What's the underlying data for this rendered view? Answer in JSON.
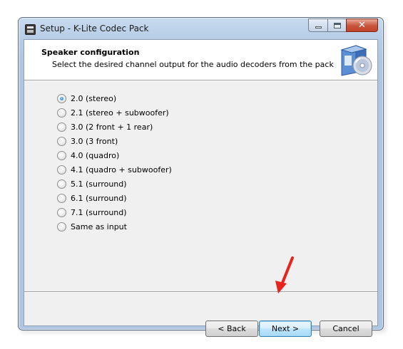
{
  "window": {
    "title": "Setup - K-Lite Codec Pack"
  },
  "header": {
    "title": "Speaker configuration",
    "subtitle": "Select the desired channel output for the audio decoders from the pack"
  },
  "options": [
    {
      "label": "2.0 (stereo)",
      "checked": true
    },
    {
      "label": "2.1 (stereo + subwoofer)",
      "checked": false
    },
    {
      "label": "3.0 (2 front + 1 rear)",
      "checked": false
    },
    {
      "label": "3.0 (3 front)",
      "checked": false
    },
    {
      "label": "4.0 (quadro)",
      "checked": false
    },
    {
      "label": "4.1 (quadro + subwoofer)",
      "checked": false
    },
    {
      "label": "5.1 (surround)",
      "checked": false
    },
    {
      "label": "6.1 (surround)",
      "checked": false
    },
    {
      "label": "7.1 (surround)",
      "checked": false
    },
    {
      "label": "Same as input",
      "checked": false
    }
  ],
  "buttons": {
    "back": "< Back",
    "next": "Next >",
    "cancel": "Cancel"
  },
  "caption": {
    "close": "✕"
  },
  "colors": {
    "annotation_arrow": "#e8231b",
    "close_button": "#c8533b"
  }
}
